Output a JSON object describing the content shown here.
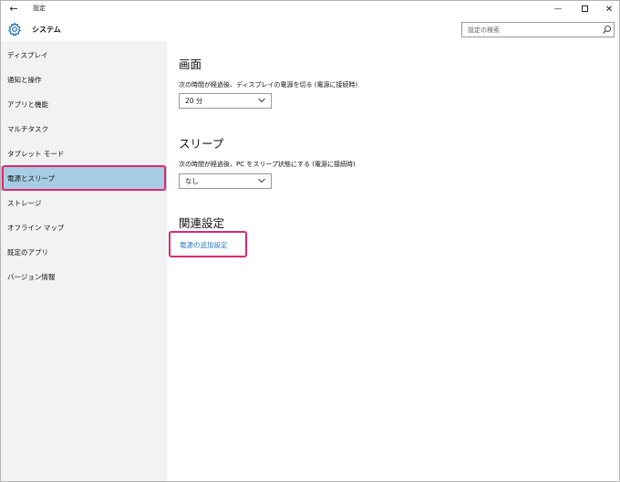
{
  "window": {
    "back_glyph": "←",
    "title": "設定",
    "minimize_glyph": "—",
    "close_glyph": "✕"
  },
  "header": {
    "title": "システム",
    "search_placeholder": "設定の検索"
  },
  "sidebar": {
    "items": [
      {
        "label": "ディスプレイ"
      },
      {
        "label": "通知と操作"
      },
      {
        "label": "アプリと機能"
      },
      {
        "label": "マルチタスク"
      },
      {
        "label": "タブレット モード"
      },
      {
        "label": "電源とスリープ"
      },
      {
        "label": "ストレージ"
      },
      {
        "label": "オフライン マップ"
      },
      {
        "label": "既定のアプリ"
      },
      {
        "label": "バージョン情報"
      }
    ],
    "selected_index": 5
  },
  "main": {
    "screen": {
      "title": "画面",
      "desc": "次の時間が経過後、ディスプレイの電源を切る (電源に接続時)",
      "value": "20 分"
    },
    "sleep": {
      "title": "スリープ",
      "desc": "次の時間が経過後、PC をスリープ状態にする (電源に接続時)",
      "value": "なし"
    },
    "related": {
      "title": "関連設定",
      "link": "電源の追加設定"
    }
  },
  "colors": {
    "selected_bg": "#a6cde3",
    "highlight": "#e0286e",
    "link": "#2b79c2",
    "sidebar_bg": "#f2f2f2"
  }
}
